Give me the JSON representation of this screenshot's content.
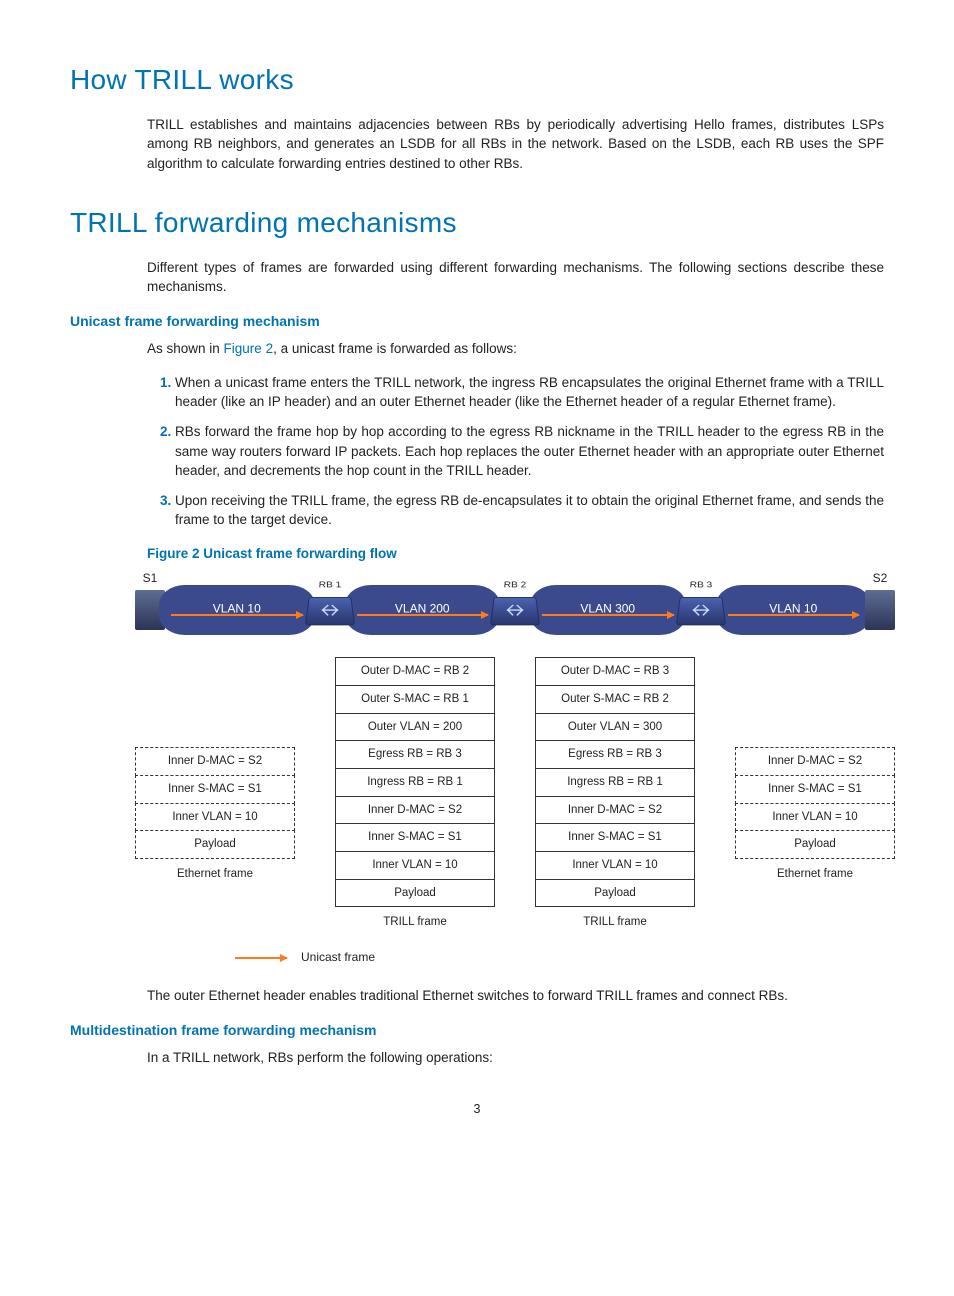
{
  "h1a": "How TRILL works",
  "p1": "TRILL establishes and maintains adjacencies between RBs by periodically advertising Hello frames, distributes LSPs among RB neighbors, and generates an LSDB for all RBs in the network. Based on the LSDB, each RB uses the SPF algorithm to calculate forwarding entries destined to other RBs.",
  "h1b": "TRILL forwarding mechanisms",
  "p2": "Different types of frames are forwarded using different forwarding mechanisms. The following sections describe these mechanisms.",
  "sub1": "Unicast frame forwarding mechanism",
  "p3a": "As shown in ",
  "p3link": "Figure 2",
  "p3b": ", a unicast frame is forwarded as follows:",
  "li1": "When a unicast frame enters the TRILL network, the ingress RB encapsulates the original Ethernet frame with a TRILL header (like an IP header) and an outer Ethernet header (like the Ethernet header of a regular Ethernet frame).",
  "li2": "RBs forward the frame hop by hop according to the egress RB nickname in the TRILL header to the egress RB in the same way routers forward IP packets. Each hop replaces the outer Ethernet header with an appropriate outer Ethernet header, and decrements the hop count in the TRILL header.",
  "li3": "Upon receiving the TRILL frame, the egress RB de-encapsulates it to obtain the original Ethernet frame, and sends the frame to the target device.",
  "figTitle": "Figure 2 Unicast frame forwarding flow",
  "topo": {
    "s1": "S1",
    "s2": "S2",
    "rb1": "RB 1",
    "rb2": "RB 2",
    "rb3": "RB 3",
    "vlan10": "VLAN 10",
    "vlan200": "VLAN 200",
    "vlan300": "VLAN 300"
  },
  "stacks": {
    "ethLeft": [
      "Inner D-MAC = S2",
      "Inner S-MAC = S1",
      "Inner VLAN = 10",
      "Payload"
    ],
    "trill1": [
      "Outer D-MAC = RB 2",
      "Outer S-MAC = RB 1",
      "Outer VLAN = 200",
      "Egress RB = RB 3",
      "Ingress RB = RB 1",
      "Inner D-MAC = S2",
      "Inner S-MAC = S1",
      "Inner VLAN = 10",
      "Payload"
    ],
    "trill2": [
      "Outer D-MAC = RB 3",
      "Outer S-MAC = RB 2",
      "Outer VLAN = 300",
      "Egress RB = RB 3",
      "Ingress RB = RB 1",
      "Inner D-MAC = S2",
      "Inner S-MAC = S1",
      "Inner VLAN = 10",
      "Payload"
    ],
    "ethRight": [
      "Inner D-MAC = S2",
      "Inner S-MAC = S1",
      "Inner VLAN = 10",
      "Payload"
    ],
    "labels": [
      "Ethernet frame",
      "TRILL frame",
      "TRILL frame",
      "Ethernet frame"
    ]
  },
  "legend": "Unicast frame",
  "p4": "The outer Ethernet header enables traditional Ethernet switches to forward TRILL frames and connect RBs.",
  "sub2": "Multidestination frame forwarding mechanism",
  "p5": "In a TRILL network, RBs perform the following operations:",
  "pageNum": "3"
}
